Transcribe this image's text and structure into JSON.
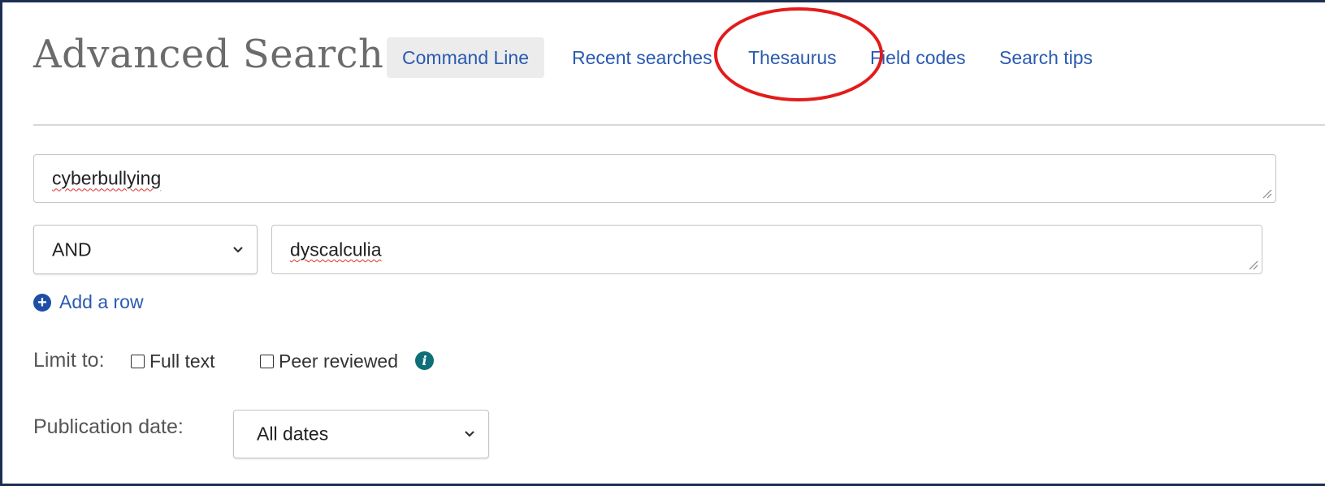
{
  "page": {
    "title": "Advanced Search"
  },
  "nav": {
    "command_line": "Command Line",
    "recent_searches": "Recent searches",
    "thesaurus": "Thesaurus",
    "field_codes": "Field codes",
    "search_tips": "Search tips"
  },
  "search": {
    "row1_value": "cyberbullying",
    "row2_operator": "AND",
    "row2_value": "dyscalculia",
    "add_row": "Add a row"
  },
  "limits": {
    "label": "Limit to:",
    "full_text": "Full text",
    "full_text_checked": false,
    "peer_reviewed": "Peer reviewed",
    "peer_reviewed_checked": false
  },
  "publication_date": {
    "label": "Publication date:",
    "selected": "All dates"
  },
  "colors": {
    "link": "#2a5ab0",
    "annotation": "#e31b1b",
    "info_icon": "#0e6f78"
  }
}
